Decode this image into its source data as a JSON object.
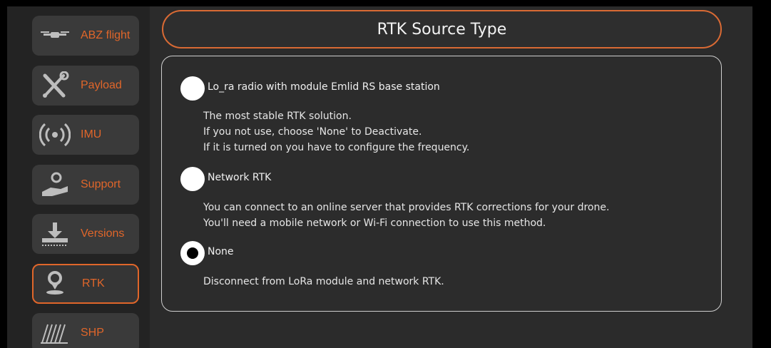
{
  "sidebar": {
    "items": [
      {
        "label": "ABZ flight",
        "icon": "drone-icon"
      },
      {
        "label": "Payload",
        "icon": "tools-icon"
      },
      {
        "label": "IMU",
        "icon": "signal-icon"
      },
      {
        "label": "Support",
        "icon": "support-hand-icon"
      },
      {
        "label": "Versions",
        "icon": "download-icon"
      },
      {
        "label": "RTK",
        "icon": "location-pin-icon",
        "active": true
      },
      {
        "label": "SHP",
        "icon": "field-icon"
      }
    ]
  },
  "header": {
    "title": "RTK Source Type"
  },
  "options": [
    {
      "label": "Lo_ra radio with module Emlid RS base station",
      "selected": false,
      "description": [
        "The most stable RTK solution.",
        "If you not use, choose 'None' to Deactivate.",
        "If it is turned on you have to configure the frequency."
      ]
    },
    {
      "label": "Network RTK",
      "selected": false,
      "description": [
        "You can connect to an online server that provides RTK corrections for your drone.",
        "You'll need a mobile network or Wi-Fi connection to use this method."
      ]
    },
    {
      "label": "None",
      "selected": true,
      "description": [
        "Disconnect from LoRa module and network RTK."
      ]
    }
  ],
  "colors": {
    "accent": "#e0662a",
    "background": "#2b2b2b",
    "sidebar": "#232323"
  }
}
